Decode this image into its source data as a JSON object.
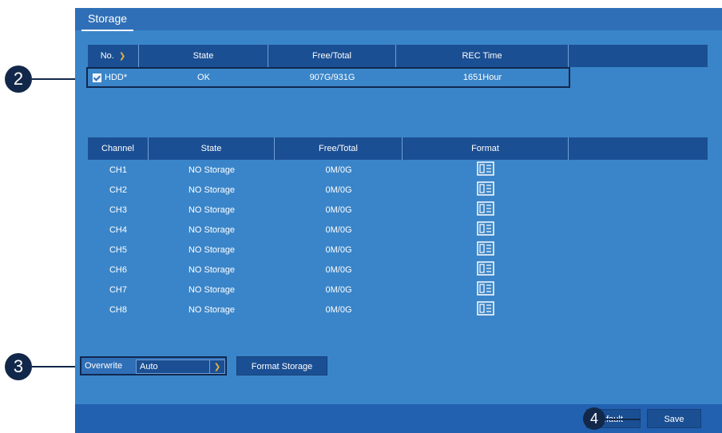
{
  "page": {
    "tab": "Storage"
  },
  "hdd_table": {
    "headers": [
      "No.",
      "State",
      "Free/Total",
      "REC Time"
    ],
    "row": {
      "checked": true,
      "no": "HDD*",
      "state": "OK",
      "free_total": "907G/931G",
      "rec_time": "1651Hour"
    }
  },
  "channel_table": {
    "headers": [
      "Channel",
      "State",
      "Free/Total",
      "Format"
    ],
    "rows": [
      {
        "channel": "CH1",
        "state": "NO Storage",
        "free_total": "0M/0G"
      },
      {
        "channel": "CH2",
        "state": "NO Storage",
        "free_total": "0M/0G"
      },
      {
        "channel": "CH3",
        "state": "NO Storage",
        "free_total": "0M/0G"
      },
      {
        "channel": "CH4",
        "state": "NO Storage",
        "free_total": "0M/0G"
      },
      {
        "channel": "CH5",
        "state": "NO Storage",
        "free_total": "0M/0G"
      },
      {
        "channel": "CH6",
        "state": "NO Storage",
        "free_total": "0M/0G"
      },
      {
        "channel": "CH7",
        "state": "NO Storage",
        "free_total": "0M/0G"
      },
      {
        "channel": "CH8",
        "state": "NO Storage",
        "free_total": "0M/0G"
      }
    ]
  },
  "overwrite": {
    "label": "Overwrite",
    "value": "Auto"
  },
  "buttons": {
    "format_storage": "Format Storage",
    "default": ":fault",
    "save": "Save"
  },
  "callouts": [
    "2",
    "3",
    "4"
  ],
  "colors": {
    "panel": "#3a85c9",
    "header": "#1b4f93",
    "accent": "#f0b23a",
    "callout": "#12284a"
  }
}
